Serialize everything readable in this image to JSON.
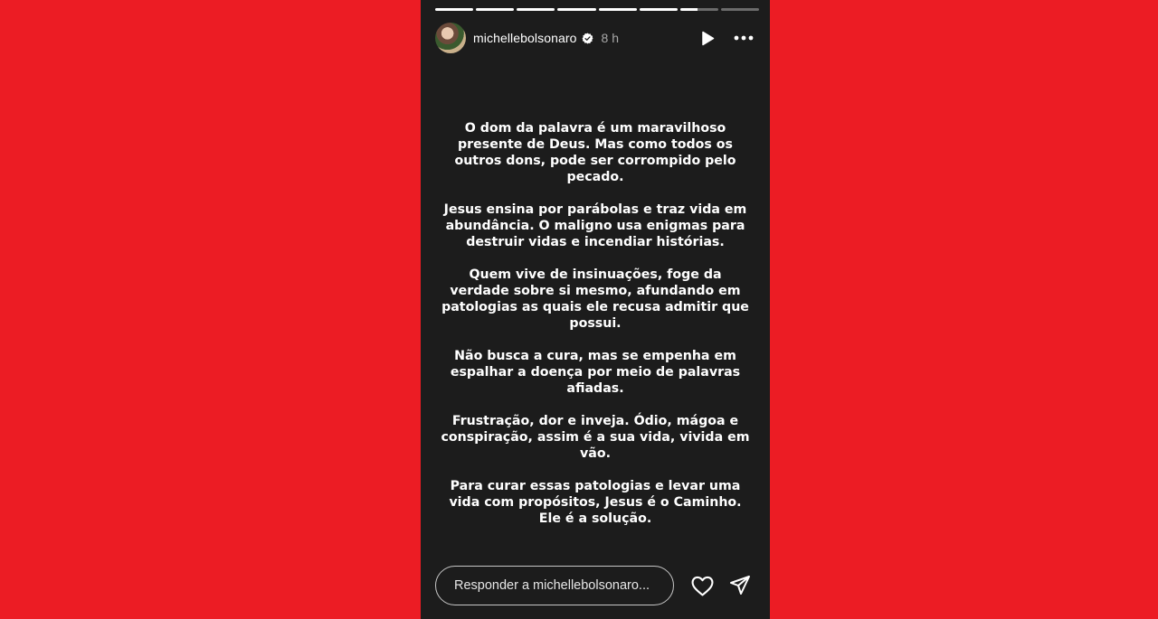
{
  "colors": {
    "background": "#ec1c24",
    "story_bg": "#1c1c1c",
    "text": "#ffffff",
    "muted": "#a8a8a8"
  },
  "progress": {
    "segments": 8,
    "completed": 6,
    "current_fraction": 0.45
  },
  "header": {
    "username": "michellebolsonaro",
    "time": "8 h",
    "verified_icon": "verified-badge-icon",
    "play_icon": "play-icon",
    "more_icon": "more-options-icon"
  },
  "story_text": {
    "p1": "O dom da palavra é um maravilhoso presente de Deus. Mas como todos os outros dons, pode ser corrompido pelo pecado.",
    "p2": "Jesus ensina por parábolas e traz vida em abundância. O maligno usa enigmas para destruir vidas e incendiar histórias.",
    "p3": "Quem vive de insinuações, foge da verdade sobre si mesmo, afundando em patologias as quais ele recusa admitir que possui.",
    "p4": "Não busca a cura, mas se empenha em espalhar a doença por meio de palavras afiadas.",
    "p5": "Frustração, dor e inveja. Ódio, mágoa e conspiração, assim é a sua vida, vivida em vão.",
    "p6": "Para curar essas patologias e levar uma vida com propósitos, Jesus é o Caminho. Ele é a solução."
  },
  "footer": {
    "reply_placeholder": "Responder a michellebolsonaro...",
    "heart_icon": "heart-icon",
    "share_icon": "send-icon"
  }
}
